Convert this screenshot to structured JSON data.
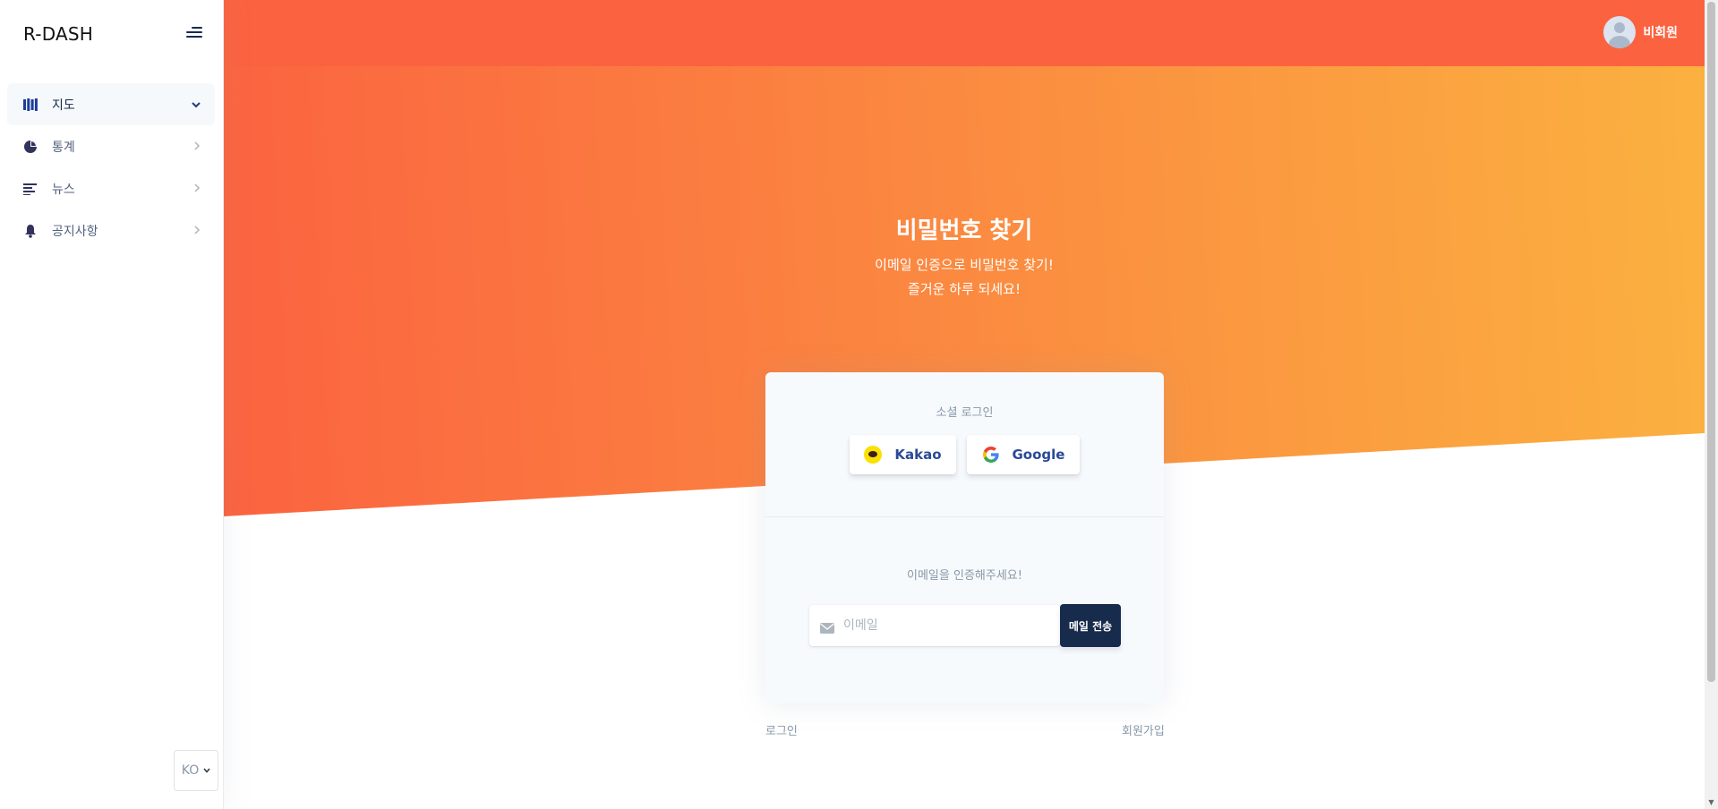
{
  "sidebar": {
    "brand": "R-DASH",
    "items": [
      {
        "label": "지도",
        "icon": "map-icon",
        "active": true
      },
      {
        "label": "통계",
        "icon": "pie-chart-icon",
        "active": false
      },
      {
        "label": "뉴스",
        "icon": "news-lines-icon",
        "active": false
      },
      {
        "label": "공지사항",
        "icon": "bell-icon",
        "active": false
      }
    ],
    "language": "KO"
  },
  "header": {
    "username": "비회원"
  },
  "hero": {
    "title": "비밀번호 찾기",
    "subtitle_line1": "이메일 인증으로 비밀번호 찾기!",
    "subtitle_line2": "즐거운 하루 되세요!"
  },
  "card": {
    "social_label": "소셜 로그인",
    "kakao_label": "Kakao",
    "google_label": "Google",
    "verify_label": "이메일을 인증해주세요!",
    "email_placeholder": "이메일",
    "email_value": "",
    "send_button": "메일 전송"
  },
  "footer_links": {
    "login": "로그인",
    "signup": "회원가입"
  },
  "colors": {
    "accent_orange": "#fb6340",
    "gradient_end": "#fbb140",
    "primary_dark": "#172b4d",
    "kakao_yellow": "#fae100"
  }
}
